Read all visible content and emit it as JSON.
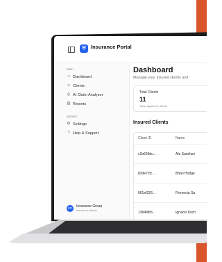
{
  "app": {
    "title": "Insurance Portal",
    "logo_icon": "shield-icon"
  },
  "sidebar": {
    "main_label": "Main",
    "main_items": [
      {
        "label": "Dashboard",
        "icon": "home-icon"
      },
      {
        "label": "Clients",
        "icon": "users-icon"
      },
      {
        "label": "AI Claim Analyzer",
        "icon": "ai-icon"
      },
      {
        "label": "Reports",
        "icon": "chart-icon"
      }
    ],
    "system_label": "System",
    "system_items": [
      {
        "label": "Settings",
        "icon": "gear-icon"
      },
      {
        "label": "Help & Support",
        "icon": "help-icon"
      }
    ],
    "footer": {
      "initials": "CP",
      "name": "Insurance Group",
      "role": "Insurance Admin"
    }
  },
  "main": {
    "title": "Dashboard",
    "subtitle": "Manage your insured clients and",
    "stat": {
      "label": "Total Clients",
      "value": "11",
      "caption": "Total registered clients"
    },
    "table": {
      "title": "Insured Clients",
      "columns": [
        "Client ID",
        "Name"
      ],
      "rows": [
        [
          "c1b669dc...",
          "Ale Sanchez"
        ],
        [
          "82de7cfc...",
          "Brian Hodge"
        ],
        [
          "661ef226...",
          "Florencia Sa"
        ],
        [
          "13b4fdb6...",
          "Ignacio Koch"
        ]
      ]
    }
  },
  "colors": {
    "accent": "#2563eb",
    "orange": "#d9552c",
    "bezel": "#1c1c1e"
  }
}
